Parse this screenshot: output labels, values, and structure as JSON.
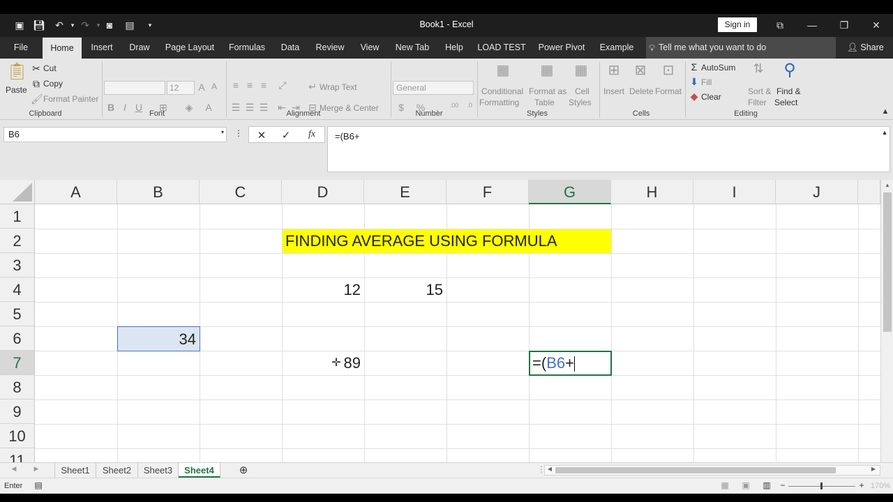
{
  "title_bar": {
    "doc_title": "Book1  -  Excel",
    "sign_in": "Sign in"
  },
  "menu": {
    "tabs": [
      "File",
      "Home",
      "Insert",
      "Draw",
      "Page Layout",
      "Formulas",
      "Data",
      "Review",
      "View",
      "New Tab",
      "Help",
      "LOAD TEST",
      "Power Pivot",
      "Example"
    ],
    "active": "Home",
    "tell_me": "Tell me what you want to do",
    "share": "Share"
  },
  "ribbon": {
    "clipboard": {
      "paste": "Paste",
      "cut": "Cut",
      "copy": "Copy",
      "format_painter": "Format Painter",
      "label": "Clipboard"
    },
    "font": {
      "size": "12",
      "label": "Font",
      "bold": "B",
      "italic": "I",
      "underline": "U"
    },
    "alignment": {
      "wrap": "Wrap Text",
      "merge": "Merge & Center",
      "label": "Alignment"
    },
    "number": {
      "format": "General",
      "label": "Number"
    },
    "styles": {
      "conditional": "Conditional",
      "conditional2": "Formatting",
      "format_as": "Format as",
      "table": "Table",
      "cell": "Cell",
      "styles": "Styles",
      "label": "Styles"
    },
    "cells": {
      "insert": "Insert",
      "delete": "Delete",
      "format": "Format",
      "label": "Cells"
    },
    "editing": {
      "autosum": "AutoSum",
      "fill": "Fill",
      "clear": "Clear",
      "sort": "Sort &",
      "filter": "Filter",
      "find": "Find &",
      "select": "Select",
      "label": "Editing"
    }
  },
  "formula_bar": {
    "name_box": "B6",
    "formula": "=(B6+"
  },
  "grid": {
    "columns": [
      "A",
      "B",
      "C",
      "D",
      "E",
      "F",
      "G",
      "H",
      "I",
      "J"
    ],
    "rows": [
      "1",
      "2",
      "3",
      "4",
      "5",
      "6",
      "7",
      "8",
      "9",
      "10",
      "11"
    ],
    "cells": {
      "D2": "FINDING AVERAGE USING FORMULA",
      "D4": "12",
      "E4": "15",
      "B6": "34",
      "D7": "89",
      "G7_prefix": "=(",
      "G7_ref": "B6",
      "G7_suffix": "+"
    },
    "highlight_color": "#ffff00",
    "ref_color": "#4472c4",
    "selected_column": "G",
    "selected_row": "7"
  },
  "sheets": {
    "tabs": [
      "Sheet1",
      "Sheet2",
      "Sheet3",
      "Sheet4"
    ],
    "active": "Sheet4"
  },
  "status": {
    "mode": "Enter",
    "zoom": "170%"
  },
  "colors": {
    "accent": "#217346"
  }
}
